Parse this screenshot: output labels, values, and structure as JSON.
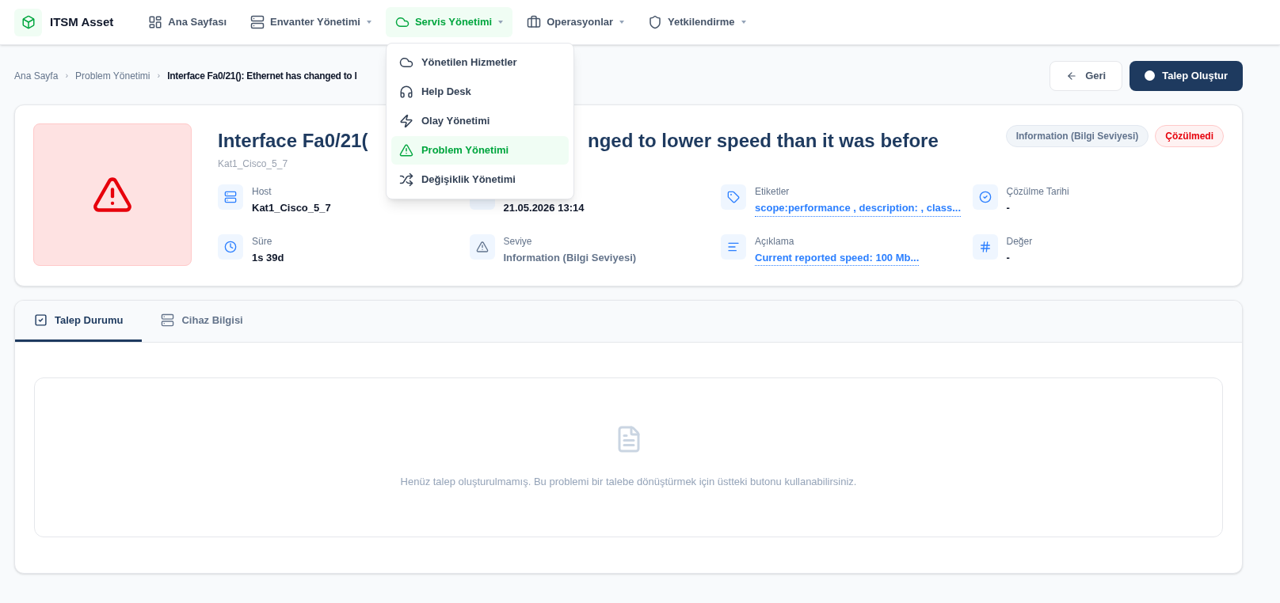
{
  "brand": "ITSM Asset",
  "nav": [
    {
      "label": "Ana Sayfası",
      "has_menu": false,
      "selected": false
    },
    {
      "label": "Envanter Yönetimi",
      "has_menu": true,
      "selected": false
    },
    {
      "label": "Servis Yönetimi",
      "has_menu": true,
      "selected": true,
      "menu": [
        {
          "label": "Yönetilen Hizmetler",
          "selected": false
        },
        {
          "label": "Help Desk",
          "selected": false
        },
        {
          "label": "Olay Yönetimi",
          "selected": false
        },
        {
          "label": "Problem Yönetimi",
          "selected": true
        },
        {
          "label": "Değişiklik Yönetimi",
          "selected": false
        }
      ]
    },
    {
      "label": "Operasyonlar",
      "has_menu": true,
      "selected": false
    },
    {
      "label": "Yetkilendirme",
      "has_menu": true,
      "selected": false
    }
  ],
  "breadcrumb": {
    "separator": "›",
    "items": [
      "Ana Sayfa",
      "Problem Yönetimi",
      "Interface Fa0/21(): Ethernet has changed to l"
    ]
  },
  "actions": [
    {
      "label": "Geri",
      "kind": "back"
    },
    {
      "label": "Talep Oluştur",
      "kind": "primary"
    }
  ],
  "problem": {
    "title_parts": [
      "Interface Fa0/21(",
      "nged to lower speed than it was before"
    ],
    "subtitle": "Kat1_Cisco_5_7",
    "badges": [
      {
        "label": "Information (Bilgi Seviyesi)",
        "kind": "neutral"
      },
      {
        "label": "Çözülmedi",
        "kind": "danger"
      }
    ],
    "fields": [
      {
        "label": "Host",
        "value": "Kat1_Cisco_5_7",
        "kind": "plain"
      },
      {
        "value": "21.05.2026 13:14",
        "kind": "plain"
      },
      {
        "label": "Etiketler",
        "value": "scope:performance , description: , class...",
        "kind": "link"
      },
      {
        "label": "Çözülme Tarihi",
        "value": "-",
        "kind": "plain"
      },
      {
        "label": "Süre",
        "value": "1s 39d",
        "kind": "plain"
      },
      {
        "label": "Seviye",
        "value": "Information (Bilgi Seviyesi)",
        "kind": "muted"
      },
      {
        "label": "Açıklama",
        "value": "Current reported speed: 100 Mb...",
        "kind": "link"
      },
      {
        "label": "Değer",
        "value": "-",
        "kind": "plain"
      }
    ]
  },
  "tabs": [
    {
      "label": "Talep Durumu",
      "selected": true
    },
    {
      "label": "Cihaz Bilgisi",
      "selected": false
    }
  ],
  "empty_state": {
    "message": "Henüz talep oluşturulmamış. Bu problemi bir talebe dönüştürmek için üstteki butonu kullanabilirsiniz."
  }
}
